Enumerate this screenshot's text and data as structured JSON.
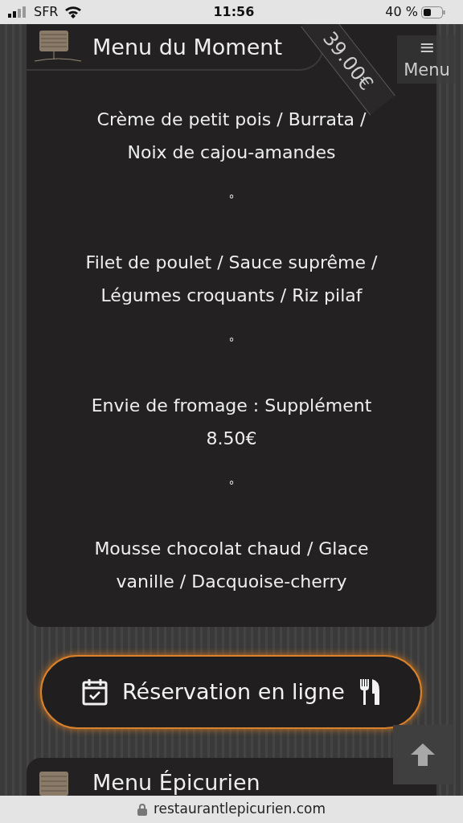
{
  "status_bar": {
    "carrier": "SFR",
    "time": "11:56",
    "battery": "40 %"
  },
  "menu_button": {
    "icon": "≡",
    "label": "Menu"
  },
  "menu_card": {
    "title": "Menu du Moment",
    "price": "39.00€",
    "courses": [
      {
        "kind": "dish",
        "text": "Crème de petit pois / Burrata / Noix de cajou-amandes"
      },
      {
        "kind": "separator",
        "text": "°"
      },
      {
        "kind": "dish",
        "text": "Filet de poulet / Sauce suprême / Légumes croquants / Riz pilaf"
      },
      {
        "kind": "separator",
        "text": "°"
      },
      {
        "kind": "dish",
        "text": "Envie de fromage : Supplément 8.50€"
      },
      {
        "kind": "separator",
        "text": "°"
      },
      {
        "kind": "dish",
        "text": "Mousse chocolat chaud / Glace vanille / Dacquoise-cherry"
      }
    ]
  },
  "reservation_button": {
    "label": "Réservation en ligne"
  },
  "next_card": {
    "title": "Menu Épicurien"
  },
  "url_bar": {
    "url": "restaurantlepicurien.com"
  }
}
